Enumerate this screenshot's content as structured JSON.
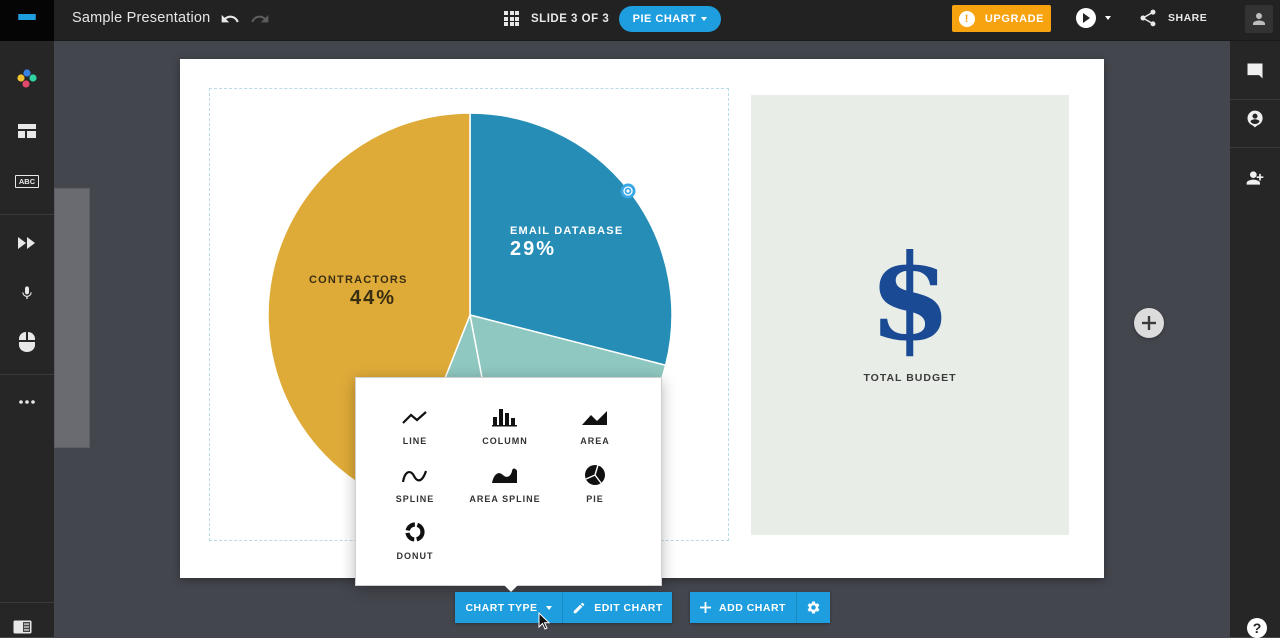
{
  "app": {
    "title": "Sample Presentation",
    "slide_counter": "SLIDE 3 OF 3",
    "layout_selector": "PIE CHART",
    "upgrade_label": "UPGRADE",
    "share_label": "SHARE",
    "accent_color": "#1e9ede",
    "upgrade_color": "#f7a20f"
  },
  "left_sidebar": {
    "items": [
      {
        "icon": "palette-icon"
      },
      {
        "icon": "layout-icon"
      },
      {
        "icon": "text-icon",
        "label": "ABC"
      },
      {
        "icon": "animation-icon"
      },
      {
        "icon": "microphone-icon"
      },
      {
        "icon": "mouse-icon"
      },
      {
        "icon": "more-icon"
      }
    ]
  },
  "right_sidebar": {
    "items": [
      {
        "icon": "comment-icon"
      },
      {
        "icon": "account-pin-icon"
      },
      {
        "icon": "add-person-icon"
      }
    ],
    "help_label": "?"
  },
  "slide": {
    "side_panel": {
      "symbol": "$",
      "caption": "TOTAL BUDGET"
    }
  },
  "chart_data": {
    "type": "pie",
    "slices": [
      {
        "label": "EMAIL DATABASE",
        "value": 29,
        "display": "29%",
        "color": "#268db6",
        "labeled": true
      },
      {
        "label": "",
        "value": 18,
        "display": "",
        "color": "#8fc8c0",
        "labeled": false
      },
      {
        "label": "",
        "value": 9,
        "display": "",
        "color": "#8fc8c0",
        "labeled": false
      },
      {
        "label": "CONTRACTORS",
        "value": 44,
        "display": "44%",
        "color": "#dfab38",
        "labeled": true
      }
    ],
    "start_angle_deg": 0,
    "direction": "clockwise"
  },
  "chart_type_menu": {
    "options": [
      {
        "label": "LINE",
        "icon": "line-chart-icon"
      },
      {
        "label": "COLUMN",
        "icon": "column-chart-icon"
      },
      {
        "label": "AREA",
        "icon": "area-chart-icon"
      },
      {
        "label": "SPLINE",
        "icon": "spline-chart-icon"
      },
      {
        "label": "AREA SPLINE",
        "icon": "area-spline-chart-icon"
      },
      {
        "label": "PIE",
        "icon": "pie-chart-icon"
      },
      {
        "label": "DONUT",
        "icon": "donut-chart-icon"
      }
    ]
  },
  "chart_toolbar": {
    "chart_type_label": "CHART TYPE",
    "edit_chart_label": "EDIT CHART",
    "add_chart_label": "ADD CHART"
  }
}
